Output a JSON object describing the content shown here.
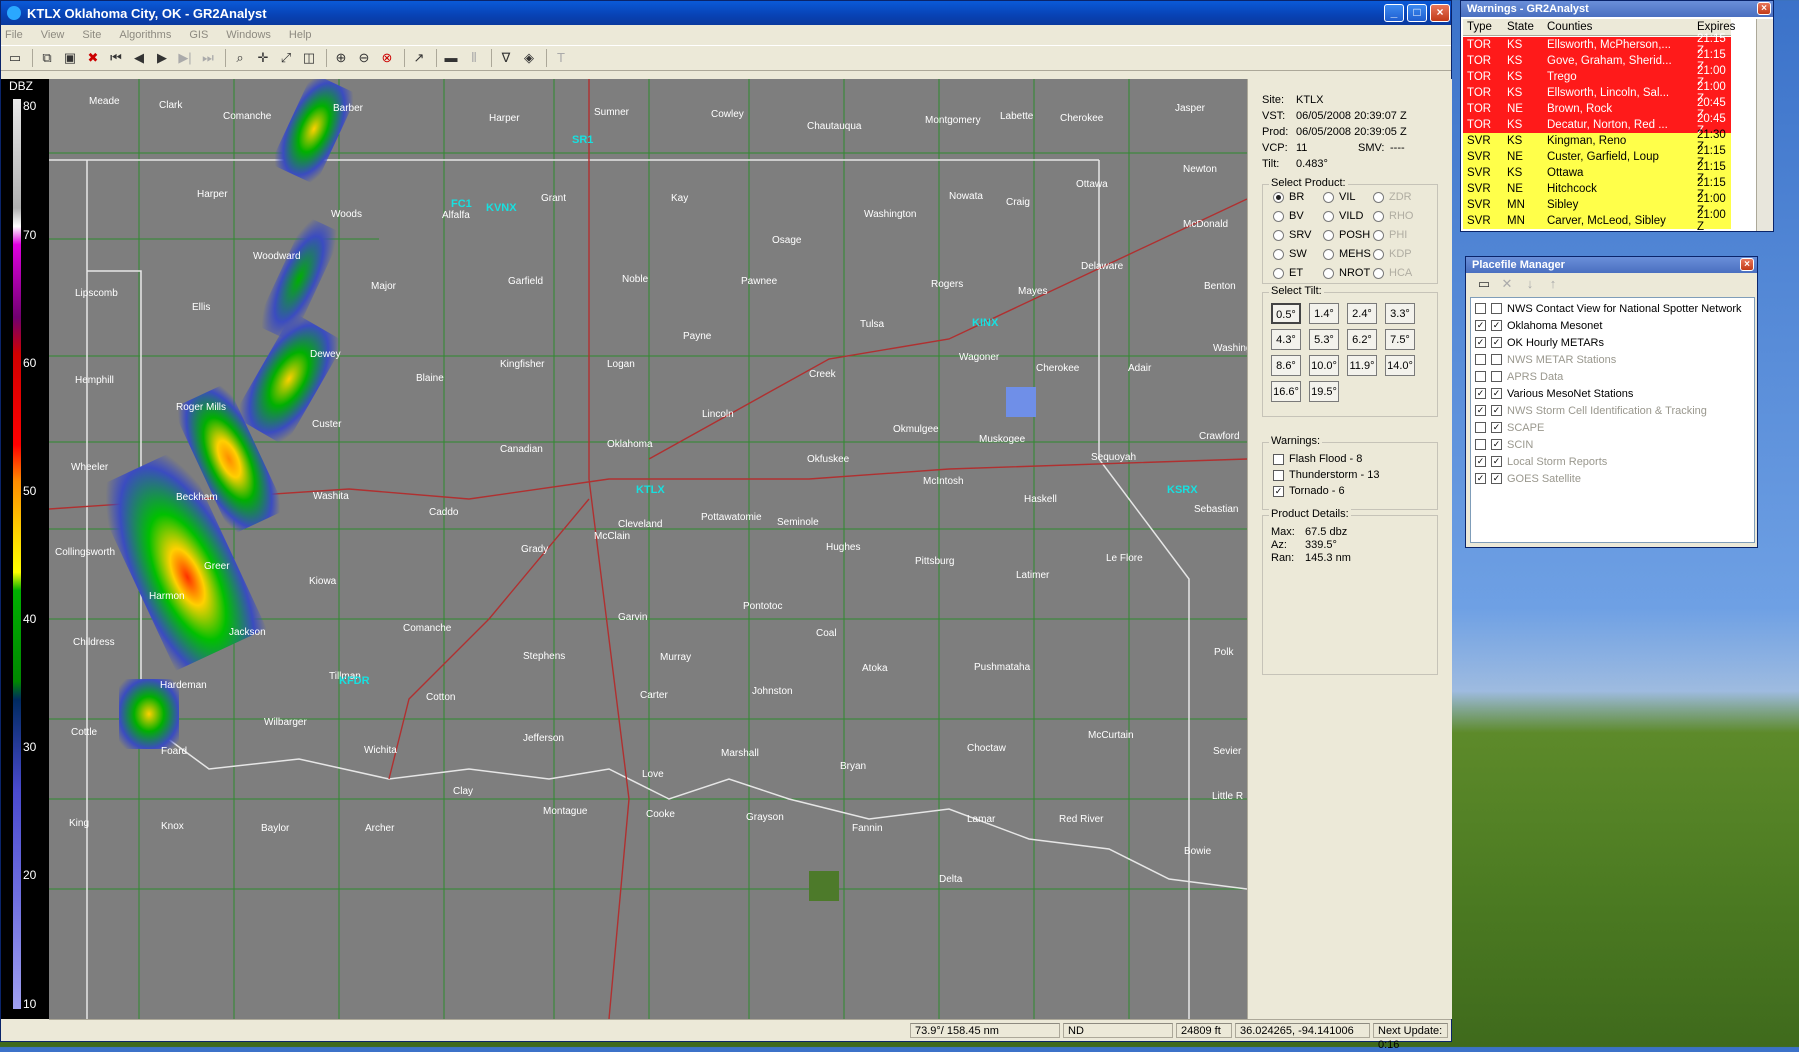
{
  "main_window": {
    "title": "KTLX Oklahoma City, OK - GR2Analyst",
    "menu": [
      "File",
      "View",
      "Site",
      "Algorithms",
      "GIS",
      "Windows",
      "Help"
    ],
    "toolbar_icons": [
      "open-folder-icon",
      "copy-icon",
      "save-icon",
      "delete-icon",
      "first-frame-icon",
      "step-back-icon",
      "play-icon",
      "step-forward-icon",
      "last-frame-icon",
      "zoom-icon",
      "pan-icon",
      "resize-icon",
      "layers-icon",
      "zoom-in-icon",
      "zoom-out-icon",
      "zoom-reset-icon",
      "cursor-icon",
      "bar-icon",
      "split-icon",
      "filter-icon",
      "diamond-icon",
      "text-icon"
    ]
  },
  "colorbar": {
    "label": "DBZ",
    "ticks": [
      "80",
      "70",
      "60",
      "50",
      "40",
      "30",
      "20",
      "10"
    ]
  },
  "map": {
    "counties": [
      {
        "name": "Meade"
      },
      {
        "name": "Clark"
      },
      {
        "name": "Comanche"
      },
      {
        "name": "Barber"
      },
      {
        "name": "Harper"
      },
      {
        "name": "Sumner"
      },
      {
        "name": "Cowley"
      },
      {
        "name": "Chautauqua"
      },
      {
        "name": "Montgomery"
      },
      {
        "name": "Labette"
      },
      {
        "name": "Cherokee"
      },
      {
        "name": "Jasper"
      },
      {
        "name": "Newton"
      },
      {
        "name": "McDonald"
      },
      {
        "name": "Harper"
      },
      {
        "name": "Woods"
      },
      {
        "name": "Alfalfa"
      },
      {
        "name": "Grant"
      },
      {
        "name": "Kay"
      },
      {
        "name": "Osage"
      },
      {
        "name": "Washington"
      },
      {
        "name": "Nowata"
      },
      {
        "name": "Craig"
      },
      {
        "name": "Ottawa"
      },
      {
        "name": "Delaware"
      },
      {
        "name": "Benton"
      },
      {
        "name": "Woodward"
      },
      {
        "name": "Ellis"
      },
      {
        "name": "Lipscomb"
      },
      {
        "name": "Major"
      },
      {
        "name": "Garfield"
      },
      {
        "name": "Noble"
      },
      {
        "name": "Pawnee"
      },
      {
        "name": "Rogers"
      },
      {
        "name": "Mayes"
      },
      {
        "name": "Tulsa"
      },
      {
        "name": "Wagoner"
      },
      {
        "name": "Cherokee"
      },
      {
        "name": "Adair"
      },
      {
        "name": "Washington"
      },
      {
        "name": "Hemphill"
      },
      {
        "name": "Dewey"
      },
      {
        "name": "Blaine"
      },
      {
        "name": "Kingfisher"
      },
      {
        "name": "Logan"
      },
      {
        "name": "Payne"
      },
      {
        "name": "Creek"
      },
      {
        "name": "Lincoln"
      },
      {
        "name": "Okmulgee"
      },
      {
        "name": "Muskogee"
      },
      {
        "name": "Sequoyah"
      },
      {
        "name": "Crawford"
      },
      {
        "name": "Roger Mills"
      },
      {
        "name": "Custer"
      },
      {
        "name": "Wheeler"
      },
      {
        "name": "Canadian"
      },
      {
        "name": "Oklahoma"
      },
      {
        "name": "Okfuskee"
      },
      {
        "name": "McIntosh"
      },
      {
        "name": "Haskell"
      },
      {
        "name": "Sebastian"
      },
      {
        "name": "Beckham"
      },
      {
        "name": "Washita"
      },
      {
        "name": "Caddo"
      },
      {
        "name": "Cleveland"
      },
      {
        "name": "McClain"
      },
      {
        "name": "Pottawatomie"
      },
      {
        "name": "Seminole"
      },
      {
        "name": "Hughes"
      },
      {
        "name": "Pittsburg"
      },
      {
        "name": "Latimer"
      },
      {
        "name": "Le Flore"
      },
      {
        "name": "Collingsworth"
      },
      {
        "name": "Greer"
      },
      {
        "name": "Kiowa"
      },
      {
        "name": "Grady"
      },
      {
        "name": "Harmon"
      },
      {
        "name": "Jackson"
      },
      {
        "name": "Comanche"
      },
      {
        "name": "Garvin"
      },
      {
        "name": "Pontotoc"
      },
      {
        "name": "Coal"
      },
      {
        "name": "Atoka"
      },
      {
        "name": "Pushmataha"
      },
      {
        "name": "Polk"
      },
      {
        "name": "Childress"
      },
      {
        "name": "Hardeman"
      },
      {
        "name": "Tillman"
      },
      {
        "name": "Stephens"
      },
      {
        "name": "Murray"
      },
      {
        "name": "Cotton"
      },
      {
        "name": "Carter"
      },
      {
        "name": "Johnston"
      },
      {
        "name": "McCurtain"
      },
      {
        "name": "Cottle"
      },
      {
        "name": "Foard"
      },
      {
        "name": "Wilbarger"
      },
      {
        "name": "Wichita"
      },
      {
        "name": "Jefferson"
      },
      {
        "name": "Love"
      },
      {
        "name": "Marshall"
      },
      {
        "name": "Bryan"
      },
      {
        "name": "Choctaw"
      },
      {
        "name": "Sevier"
      },
      {
        "name": "Clay"
      },
      {
        "name": "Montague"
      },
      {
        "name": "Cooke"
      },
      {
        "name": "Grayson"
      },
      {
        "name": "Fannin"
      },
      {
        "name": "Lamar"
      },
      {
        "name": "Red River"
      },
      {
        "name": "Little R"
      },
      {
        "name": "King"
      },
      {
        "name": "Knox"
      },
      {
        "name": "Baylor"
      },
      {
        "name": "Archer"
      },
      {
        "name": "Bowie"
      },
      {
        "name": "Delta"
      }
    ],
    "radar_sites": [
      "SR1",
      "FC1",
      "KVNX",
      "KINX",
      "KTLX",
      "KSRX",
      "KFDR"
    ]
  },
  "side_panel": {
    "site_info": [
      {
        "k": "Site:",
        "v": "KTLX"
      },
      {
        "k": "VST:",
        "v": "06/05/2008 20:39:07 Z"
      },
      {
        "k": "Prod:",
        "v": "06/05/2008 20:39:05 Z"
      },
      {
        "k": "VCP:",
        "v": "11"
      },
      {
        "k": "Tilt:",
        "v": "0.483°"
      }
    ],
    "smv_label": "SMV:",
    "smv_value": "----",
    "select_product_title": "Select Product:",
    "products": [
      {
        "label": "BR",
        "on": true,
        "dim": false
      },
      {
        "label": "VIL",
        "on": false,
        "dim": false
      },
      {
        "label": "ZDR",
        "on": false,
        "dim": true
      },
      {
        "label": "BV",
        "on": false,
        "dim": false
      },
      {
        "label": "VILD",
        "on": false,
        "dim": false
      },
      {
        "label": "RHO",
        "on": false,
        "dim": true
      },
      {
        "label": "SRV",
        "on": false,
        "dim": false
      },
      {
        "label": "POSH",
        "on": false,
        "dim": false
      },
      {
        "label": "PHI",
        "on": false,
        "dim": true
      },
      {
        "label": "SW",
        "on": false,
        "dim": false
      },
      {
        "label": "MEHS",
        "on": false,
        "dim": false
      },
      {
        "label": "KDP",
        "on": false,
        "dim": true
      },
      {
        "label": "ET",
        "on": false,
        "dim": false
      },
      {
        "label": "NROT",
        "on": false,
        "dim": false
      },
      {
        "label": "HCA",
        "on": false,
        "dim": true
      }
    ],
    "select_tilt_title": "Select Tilt:",
    "tilts": [
      "0.5°",
      "1.4°",
      "2.4°",
      "3.3°",
      "4.3°",
      "5.3°",
      "6.2°",
      "7.5°",
      "8.6°",
      "10.0°",
      "11.9°",
      "14.0°",
      "16.6°",
      "19.5°"
    ],
    "warnings_title": "Warnings:",
    "warning_filters": [
      {
        "label": "Flash Flood - 8",
        "checked": false
      },
      {
        "label": "Thunderstorm - 13",
        "checked": false
      },
      {
        "label": "Tornado - 6",
        "checked": true
      }
    ],
    "product_details_title": "Product Details:",
    "product_details": [
      {
        "k": "Max:",
        "v": "67.5 dbz"
      },
      {
        "k": "Az:",
        "v": "339.5°"
      },
      {
        "k": "Ran:",
        "v": "145.3 nm"
      }
    ]
  },
  "status_bar": {
    "bearing": "73.9°/ 158.45 nm",
    "nd": "ND",
    "height": "24809 ft",
    "coords": "36.024265, -94.141006",
    "next_update": "Next Update: 0:16"
  },
  "warnings_window": {
    "title": "Warnings - GR2Analyst",
    "headers": {
      "type": "Type",
      "state": "State",
      "counties": "Counties",
      "expires": "Expires"
    },
    "rows": [
      {
        "type": "TOR",
        "state": "KS",
        "counties": "Ellsworth, McPherson,...",
        "expires": "21:15 Z",
        "color": "#ff1a1a"
      },
      {
        "type": "TOR",
        "state": "KS",
        "counties": "Gove, Graham, Sherid...",
        "expires": "21:15 Z",
        "color": "#ff1a1a"
      },
      {
        "type": "TOR",
        "state": "KS",
        "counties": "Trego",
        "expires": "21:00 Z",
        "color": "#ff1a1a"
      },
      {
        "type": "TOR",
        "state": "KS",
        "counties": "Ellsworth, Lincoln, Sal...",
        "expires": "21:00 Z",
        "color": "#ff1a1a"
      },
      {
        "type": "TOR",
        "state": "NE",
        "counties": "Brown, Rock",
        "expires": "20:45 Z",
        "color": "#ff1a1a"
      },
      {
        "type": "TOR",
        "state": "KS",
        "counties": "Decatur, Norton, Red ...",
        "expires": "20:45 Z",
        "color": "#ff1a1a"
      },
      {
        "type": "SVR",
        "state": "KS",
        "counties": "Kingman, Reno",
        "expires": "21:30 Z",
        "color": "#ffff4a"
      },
      {
        "type": "SVR",
        "state": "NE",
        "counties": "Custer, Garfield, Loup",
        "expires": "21:15 Z",
        "color": "#ffff4a"
      },
      {
        "type": "SVR",
        "state": "KS",
        "counties": "Ottawa",
        "expires": "21:15 Z",
        "color": "#ffff4a"
      },
      {
        "type": "SVR",
        "state": "NE",
        "counties": "Hitchcock",
        "expires": "21:15 Z",
        "color": "#ffff4a"
      },
      {
        "type": "SVR",
        "state": "MN",
        "counties": "Sibley",
        "expires": "21:00 Z",
        "color": "#ffff4a"
      },
      {
        "type": "SVR",
        "state": "MN",
        "counties": "Carver, McLeod, Sibley",
        "expires": "21:00 Z",
        "color": "#ffff4a"
      }
    ]
  },
  "placefile_window": {
    "title": "Placefile Manager",
    "items": [
      {
        "label": "NWS Contact View for National Spotter Network",
        "enabled": false,
        "visible": false,
        "dim": false
      },
      {
        "label": "Oklahoma Mesonet",
        "enabled": true,
        "visible": true,
        "dim": false
      },
      {
        "label": "OK Hourly METARs",
        "enabled": true,
        "visible": true,
        "dim": false
      },
      {
        "label": "NWS METAR Stations",
        "enabled": false,
        "visible": false,
        "dim": true
      },
      {
        "label": "APRS Data",
        "enabled": false,
        "visible": false,
        "dim": true
      },
      {
        "label": "Various MesoNet Stations",
        "enabled": true,
        "visible": true,
        "dim": false
      },
      {
        "label": "NWS Storm Cell Identification & Tracking",
        "enabled": true,
        "visible": true,
        "dim": true
      },
      {
        "label": "SCAPE",
        "enabled": false,
        "visible": true,
        "dim": true
      },
      {
        "label": "SCIN",
        "enabled": false,
        "visible": true,
        "dim": true
      },
      {
        "label": "Local Storm Reports",
        "enabled": true,
        "visible": true,
        "dim": true
      },
      {
        "label": "GOES Satellite",
        "enabled": true,
        "visible": true,
        "dim": true
      }
    ]
  }
}
